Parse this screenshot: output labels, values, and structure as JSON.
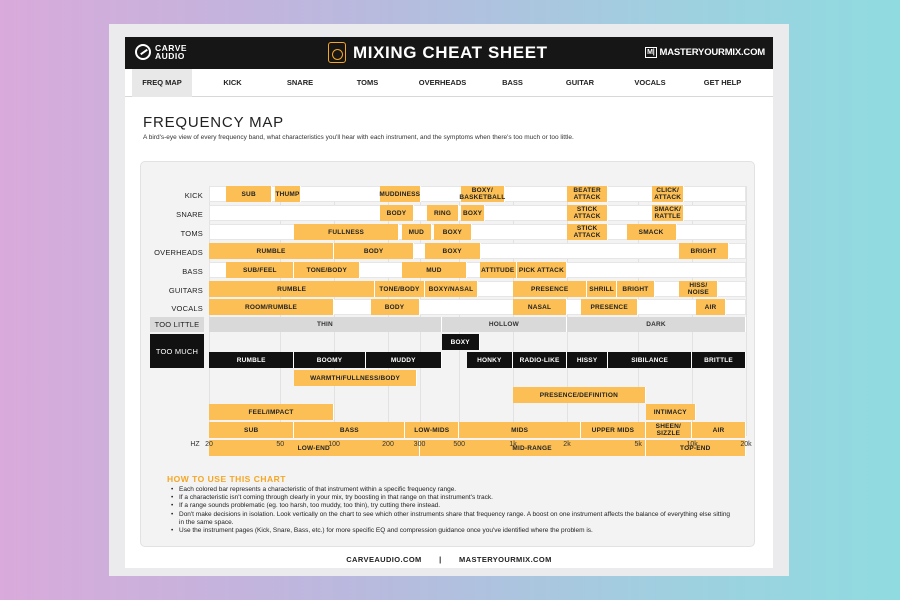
{
  "header": {
    "brand_line1": "CARVE",
    "brand_line2": "AUDIO",
    "title": "MIXING CHEAT SHEET",
    "url_icon": "M|",
    "url": "MASTERYOURMIX.COM"
  },
  "nav": [
    {
      "label": "FREQ MAP",
      "active": true
    },
    {
      "label": "KICK"
    },
    {
      "label": "SNARE"
    },
    {
      "label": "TOMS"
    },
    {
      "label": "OVERHEADS"
    },
    {
      "label": "BASS"
    },
    {
      "label": "GUITAR"
    },
    {
      "label": "VOCALS"
    },
    {
      "label": "GET HELP"
    }
  ],
  "page": {
    "title": "FREQUENCY MAP",
    "subtitle": "A bird's-eye view of every frequency band, what characteristics you'll hear with each instrument, and the symptoms when there's too much or too little."
  },
  "colors": {
    "orange": "#fbbf55",
    "black": "#111111",
    "gray": "#d9d9d9",
    "accent": "#f5a623"
  },
  "chart_data": {
    "type": "table",
    "x_unit": "HZ",
    "x_scale": "log",
    "x_range": [
      20,
      20000
    ],
    "ticks": [
      {
        "f": 20,
        "label": "20"
      },
      {
        "f": 50,
        "label": "50"
      },
      {
        "f": 100,
        "label": "100"
      },
      {
        "f": 200,
        "label": "200"
      },
      {
        "f": 300,
        "label": "300"
      },
      {
        "f": 500,
        "label": "500"
      },
      {
        "f": 1000,
        "label": "1k"
      },
      {
        "f": 2000,
        "label": "2k"
      },
      {
        "f": 5000,
        "label": "5k"
      },
      {
        "f": 10000,
        "label": "10k"
      },
      {
        "f": 20000,
        "label": "20k"
      }
    ],
    "instruments": [
      {
        "name": "KICK",
        "bars": [
          {
            "label": "SUB",
            "from": 25,
            "to": 45
          },
          {
            "label": "THUMP",
            "from": 47,
            "to": 65
          },
          {
            "label": "MUDDINESS",
            "from": 180,
            "to": 305
          },
          {
            "label": "BOXY/ BASKETBALL",
            "from": 510,
            "to": 900
          },
          {
            "label": "BEATER ATTACK",
            "from": 2000,
            "to": 3400
          },
          {
            "label": "CLICK/ ATTACK",
            "from": 6000,
            "to": 9000
          }
        ]
      },
      {
        "name": "SNARE",
        "bars": [
          {
            "label": "BODY",
            "from": 180,
            "to": 280
          },
          {
            "label": "RING",
            "from": 330,
            "to": 500
          },
          {
            "label": "BOXY",
            "from": 510,
            "to": 700
          },
          {
            "label": "STICK ATTACK",
            "from": 2000,
            "to": 3400
          },
          {
            "label": "SMACK/ RATTLE",
            "from": 6000,
            "to": 9000
          }
        ]
      },
      {
        "name": "TOMS",
        "bars": [
          {
            "label": "FULLNESS",
            "from": 60,
            "to": 230
          },
          {
            "label": "MUD",
            "from": 240,
            "to": 350
          },
          {
            "label": "BOXY",
            "from": 360,
            "to": 590
          },
          {
            "label": "STICK ATTACK",
            "from": 2000,
            "to": 3400
          },
          {
            "label": "SMACK",
            "from": 4300,
            "to": 8200
          }
        ]
      },
      {
        "name": "OVERHEADS",
        "bars": [
          {
            "label": "RUMBLE",
            "from": 20,
            "to": 100
          },
          {
            "label": "BODY",
            "from": 100,
            "to": 280
          },
          {
            "label": "BOXY",
            "from": 320,
            "to": 660
          },
          {
            "label": "BRIGHT",
            "from": 8500,
            "to": 16000
          }
        ]
      },
      {
        "name": "BASS",
        "bars": [
          {
            "label": "SUB/FEEL",
            "from": 25,
            "to": 60
          },
          {
            "label": "TONE/BODY",
            "from": 60,
            "to": 140
          },
          {
            "label": "MUD",
            "from": 240,
            "to": 550
          },
          {
            "label": "ATTITUDE",
            "from": 650,
            "to": 1050
          },
          {
            "label": "PICK ATTACK",
            "from": 1050,
            "to": 2000
          }
        ]
      },
      {
        "name": "GUITARS",
        "bars": [
          {
            "label": "RUMBLE",
            "from": 20,
            "to": 170
          },
          {
            "label": "TONE/BODY",
            "from": 170,
            "to": 320
          },
          {
            "label": "BOXY/NASAL",
            "from": 320,
            "to": 640
          },
          {
            "label": "PRESENCE",
            "from": 1000,
            "to": 2600
          },
          {
            "label": "SHRILL",
            "from": 2600,
            "to": 3800
          },
          {
            "label": "BRIGHT",
            "from": 3800,
            "to": 6200
          },
          {
            "label": "HISS/ NOISE",
            "from": 8500,
            "to": 14000
          }
        ]
      },
      {
        "name": "VOCALS",
        "bars": [
          {
            "label": "ROOM/RUMBLE",
            "from": 20,
            "to": 100
          },
          {
            "label": "BODY",
            "from": 160,
            "to": 300
          },
          {
            "label": "NASAL",
            "from": 1000,
            "to": 2000
          },
          {
            "label": "PRESENCE",
            "from": 2400,
            "to": 5000
          },
          {
            "label": "AIR",
            "from": 10500,
            "to": 15500
          }
        ]
      }
    ],
    "too_little": {
      "label": "TOO LITTLE",
      "bars": [
        {
          "label": "THIN",
          "from": 20,
          "to": 400
        },
        {
          "label": "HOLLOW",
          "from": 400,
          "to": 2000
        },
        {
          "label": "DARK",
          "from": 2000,
          "to": 20000
        }
      ]
    },
    "too_much": {
      "label": "TOO MUCH",
      "rows": [
        [
          {
            "label": "BOXY",
            "from": 400,
            "to": 650
          }
        ],
        [
          {
            "label": "RUMBLE",
            "from": 20,
            "to": 60
          },
          {
            "label": "BOOMY",
            "from": 60,
            "to": 150
          },
          {
            "label": "MUDDY",
            "from": 150,
            "to": 400
          },
          {
            "label": "HONKY",
            "from": 550,
            "to": 1000
          },
          {
            "label": "RADIO-LIKE",
            "from": 1000,
            "to": 2000
          },
          {
            "label": "HISSY",
            "from": 2000,
            "to": 3400
          },
          {
            "label": "SIBILANCE",
            "from": 3400,
            "to": 10000
          },
          {
            "label": "BRITTLE",
            "from": 10000,
            "to": 20000
          }
        ]
      ]
    },
    "general_rows": [
      [
        {
          "label": "WARMTH/FULLNESS/BODY",
          "from": 60,
          "to": 290
        }
      ],
      [
        {
          "label": "PRESENCE/DEFINITION",
          "from": 1000,
          "to": 5500
        }
      ],
      [
        {
          "label": "FEEL/IMPACT",
          "from": 20,
          "to": 100
        },
        {
          "label": "INTIMACY",
          "from": 5500,
          "to": 10500
        }
      ],
      [
        {
          "label": "SUB",
          "from": 20,
          "to": 60
        },
        {
          "label": "BASS",
          "from": 60,
          "to": 250
        },
        {
          "label": "LOW-MIDS",
          "from": 250,
          "to": 500
        },
        {
          "label": "MIDS",
          "from": 500,
          "to": 2400
        },
        {
          "label": "UPPER MIDS",
          "from": 2400,
          "to": 5500
        },
        {
          "label": "SHEEN/ SIZZLE",
          "from": 5500,
          "to": 10000
        },
        {
          "label": "AIR",
          "from": 10000,
          "to": 20000
        }
      ],
      [
        {
          "label": "LOW-END",
          "from": 20,
          "to": 300
        },
        {
          "label": "MID-RANGE",
          "from": 300,
          "to": 5500
        },
        {
          "label": "TOP-END",
          "from": 5500,
          "to": 20000
        }
      ]
    ]
  },
  "how_to": {
    "title": "HOW TO USE THIS CHART",
    "items": [
      "Each colored bar represents a characteristic of that instrument within a specific frequency range.",
      "If a characteristic isn't coming through clearly in your mix, try boosting in that range on that instrument's track.",
      "If a range sounds problematic (eg. too harsh, too muddy, too thin), try cutting there instead.",
      "Don't make decisions in isolation. Look vertically on the chart to see which other instruments share that frequency range. A boost on one instrument affects the balance of everything else sitting in the same space.",
      "Use the instrument pages (Kick, Snare, Bass, etc.) for more specific EQ and compression guidance once you've identified where the problem is."
    ]
  },
  "footer": {
    "left": "CARVEAUDIO.COM",
    "sep": "|",
    "right": "MASTERYOURMIX.COM"
  }
}
